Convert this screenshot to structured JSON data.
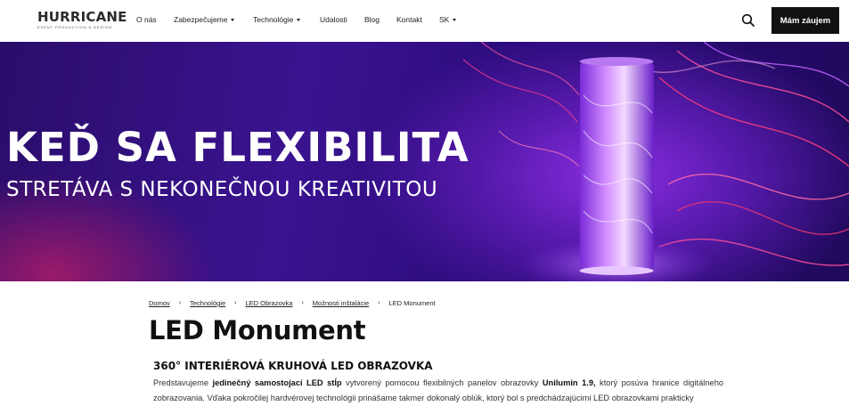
{
  "header": {
    "logo": {
      "name": "HURRICANE",
      "tagline": "EVENT PRODUCTION & DESIGN"
    },
    "nav": [
      {
        "label": "O nás",
        "has_dropdown": false
      },
      {
        "label": "Zabezpečujeme",
        "has_dropdown": true
      },
      {
        "label": "Technológie",
        "has_dropdown": true
      },
      {
        "label": "Udalosti",
        "has_dropdown": false
      },
      {
        "label": "Blog",
        "has_dropdown": false
      },
      {
        "label": "Kontakt",
        "has_dropdown": false
      },
      {
        "label": "SK",
        "has_dropdown": true
      }
    ],
    "search_icon": "search-icon",
    "cta_label": "Mám záujem"
  },
  "hero": {
    "title": "KEĎ SA FLEXIBILITA",
    "subtitle": "STRETÁVA S NEKONEČNOU KREATIVITOU"
  },
  "breadcrumb": [
    {
      "label": "Domov"
    },
    {
      "label": "Technológie"
    },
    {
      "label": "LED Obrazovka"
    },
    {
      "label": "Možnosti inštalácie"
    },
    {
      "label": "LED Monument"
    }
  ],
  "page": {
    "title": "LED Monument",
    "section_title": "360° INTERIÉROVÁ KRUHOVÁ LED OBRAZOVKA",
    "paragraph": {
      "p1": "Predstavujeme ",
      "b1": "jedinečný samostojací LED stĺp",
      "p2": " vytvorený pomocou flexibilných panelov obrazovky ",
      "b2": "Unilumin 1.9,",
      "p3": " ktorý posúva hranice digitálneho zobrazovania. Vďaka pokročilej hardvérovej technológii prinášame takmer dokonalý oblúk, ktorý bol s predchádzajúcimi LED obrazovkami prakticky"
    }
  },
  "colors": {
    "hero_bg": "#2a0d6a",
    "cta_bg": "#111111",
    "accent_pink": "#ff3d8a"
  }
}
